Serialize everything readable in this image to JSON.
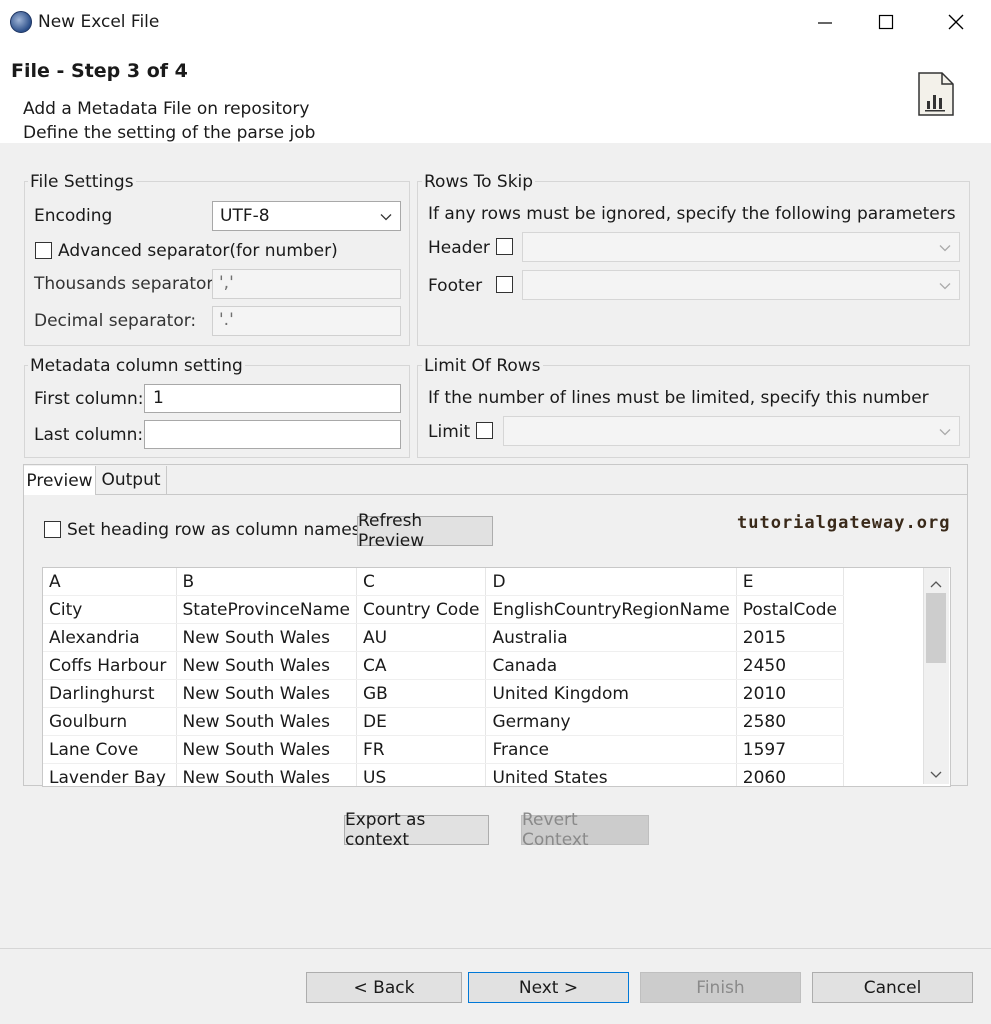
{
  "window": {
    "title": "New Excel File"
  },
  "header": {
    "step_title": "File - Step 3 of 4",
    "desc_line1": "Add a Metadata File on repository",
    "desc_line2": "Define the setting of the parse job"
  },
  "file_settings": {
    "group_label": "File Settings",
    "encoding_label": "Encoding",
    "encoding_value": "UTF-8",
    "advanced_separator_label": "Advanced separator(for number)",
    "thousands_label": "Thousands separator:",
    "thousands_value": "','",
    "decimal_label": "Decimal separator:",
    "decimal_value": "'.'"
  },
  "rows_to_skip": {
    "group_label": "Rows To Skip",
    "instruction": "If any rows must be ignored, specify the following parameters",
    "header_label": "Header",
    "footer_label": "Footer"
  },
  "metadata_column": {
    "group_label": "Metadata column setting",
    "first_label": "First column:",
    "first_value": "1",
    "last_label": "Last column:",
    "last_value": ""
  },
  "limit_of_rows": {
    "group_label": "Limit Of Rows",
    "instruction": "If the number of lines must be limited, specify this number",
    "limit_label": "Limit"
  },
  "tabs": {
    "preview": "Preview",
    "output": "Output"
  },
  "preview": {
    "heading_checkbox_label": "Set heading row as column names",
    "refresh_button": "Refresh Preview",
    "watermark": "tutorialgateway.org",
    "rows": [
      [
        "A",
        "B",
        "C",
        "D",
        "E"
      ],
      [
        "City",
        "StateProvinceName",
        "Country Code",
        "EnglishCountryRegionName",
        "PostalCode"
      ],
      [
        "Alexandria",
        "New South Wales",
        "AU",
        "Australia",
        "2015"
      ],
      [
        "Coffs Harbour",
        "New South Wales",
        "CA",
        "Canada",
        "2450"
      ],
      [
        "Darlinghurst",
        "New South Wales",
        "GB",
        "United Kingdom",
        "2010"
      ],
      [
        "Goulburn",
        "New South Wales",
        "DE",
        "Germany",
        "2580"
      ],
      [
        "Lane Cove",
        "New South Wales",
        "FR",
        "France",
        "1597"
      ],
      [
        "Lavender Bay",
        "New South Wales",
        "US",
        "United States",
        "2060"
      ]
    ]
  },
  "context_buttons": {
    "export": "Export as context",
    "revert": "Revert Context"
  },
  "footer_buttons": {
    "back": "< Back",
    "next": "Next >",
    "finish": "Finish",
    "cancel": "Cancel"
  }
}
